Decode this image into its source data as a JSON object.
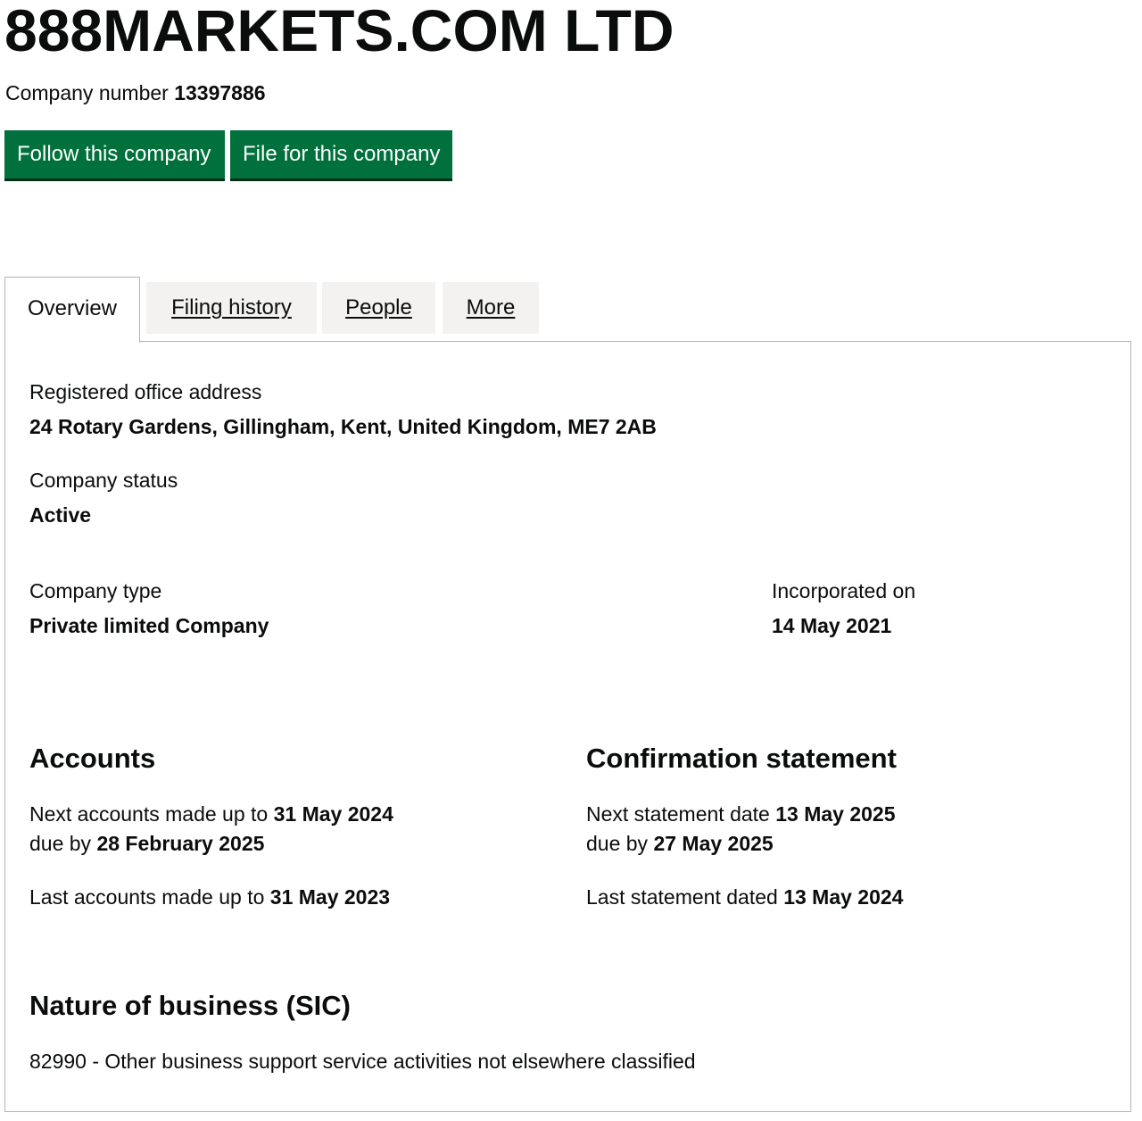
{
  "company": {
    "name": "888MARKETS.COM LTD",
    "number_label": "Company number",
    "number": "13397886"
  },
  "actions": {
    "follow_label": "Follow this company",
    "file_label": "File for this company"
  },
  "tabs": [
    {
      "label": "Overview",
      "active": true
    },
    {
      "label": "Filing history",
      "active": false
    },
    {
      "label": "People",
      "active": false
    },
    {
      "label": "More",
      "active": false
    }
  ],
  "overview": {
    "registered_office": {
      "label": "Registered office address",
      "value": "24 Rotary Gardens, Gillingham, Kent, United Kingdom, ME7 2AB"
    },
    "status": {
      "label": "Company status",
      "value": "Active"
    },
    "type": {
      "label": "Company type",
      "value": "Private limited Company"
    },
    "incorporated": {
      "label": "Incorporated on",
      "value": "14 May 2021"
    }
  },
  "accounts": {
    "heading": "Accounts",
    "next_prefix": "Next accounts made up to",
    "next_date": "31 May 2024",
    "due_prefix": "due by",
    "due_date": "28 February 2025",
    "last_prefix": "Last accounts made up to",
    "last_date": "31 May 2023"
  },
  "confirmation": {
    "heading": "Confirmation statement",
    "next_prefix": "Next statement date",
    "next_date": "13 May 2025",
    "due_prefix": "due by",
    "due_date": "27 May 2025",
    "last_prefix": "Last statement dated",
    "last_date": "13 May 2024"
  },
  "sic": {
    "heading": "Nature of business (SIC)",
    "entry": "82990 - Other business support service activities not elsewhere classified"
  }
}
